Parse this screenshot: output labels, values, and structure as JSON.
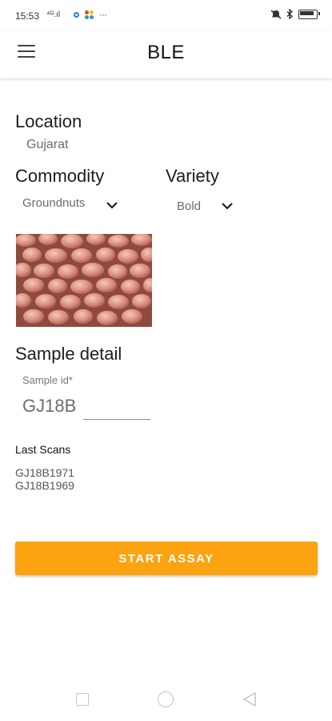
{
  "status_bar": {
    "time": "15:53",
    "network": "⁴ᴳ.ıl",
    "more": "···"
  },
  "app_bar": {
    "title": "BLE",
    "menu_icon": "hamburger-menu-icon"
  },
  "location": {
    "label": "Location",
    "value": "Gujarat"
  },
  "commodity": {
    "label": "Commodity",
    "selected": "Groundnuts"
  },
  "variety": {
    "label": "Variety",
    "selected": "Bold"
  },
  "sample_detail": {
    "heading": "Sample detail",
    "sample_id_label": "Sample id*",
    "sample_id_prefix": "GJ18B",
    "sample_id_value": ""
  },
  "last_scans": {
    "title": "Last Scans",
    "items": [
      "GJ18B1971",
      "GJ18B1969"
    ]
  },
  "actions": {
    "start_label": "START ASSAY"
  },
  "colors": {
    "accent": "#fca311"
  }
}
